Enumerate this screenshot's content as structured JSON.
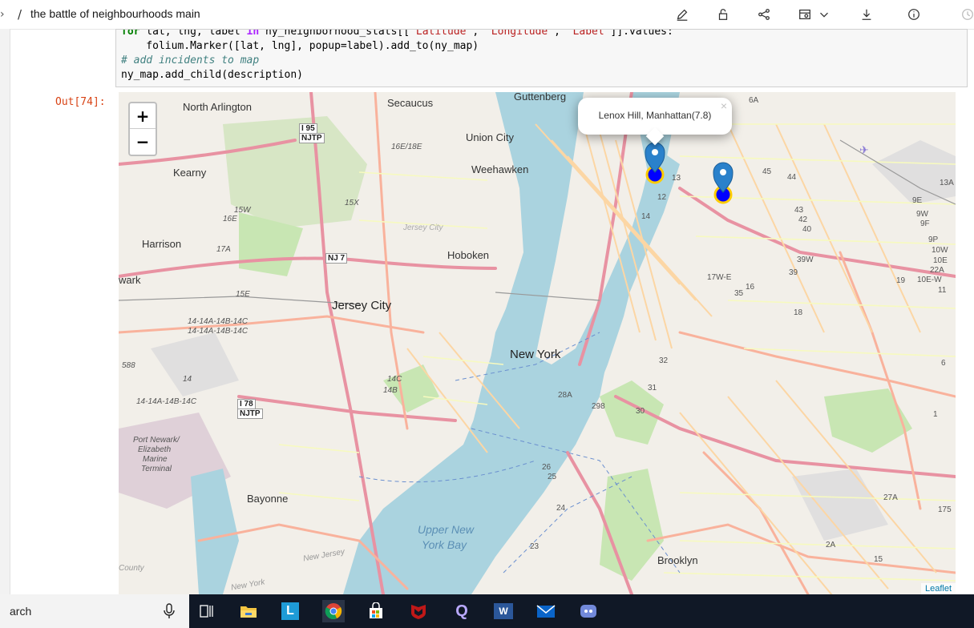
{
  "breadcrumb": {
    "separator_left": "›",
    "slash": "/",
    "title": "the battle of neighbourhoods main"
  },
  "toolbar": {
    "icons": [
      "edit-icon",
      "lock-icon",
      "share-icon",
      "version-icon",
      "chevron-down-icon",
      "download-icon",
      "info-icon"
    ]
  },
  "code": {
    "line1_kw": "for",
    "line1_mid": " lat, lng, label ",
    "line1_in": "in",
    "line1_rest": " ny_neighborhood_stats[[",
    "line1_s1": "'Latitude'",
    "line1_c1": ", ",
    "line1_s2": "'Longitude'",
    "line1_c2": ", ",
    "line1_s3": "'Label'",
    "line1_end": "]].values:",
    "line2": "    folium.Marker([lat, lng], popup=label).add_to(ny_map)",
    "line3": "# add incidents to map",
    "line4": "ny_map.add_child(description)"
  },
  "output": {
    "label": "Out[74]:"
  },
  "map": {
    "zoom_in": "+",
    "zoom_out": "−",
    "attribution": "Leaflet",
    "popup_text": "Lenox Hill, Manhattan(7.8)",
    "popup_close": "×",
    "labels": {
      "north_arlington": "North Arlington",
      "secaucus": "Secaucus",
      "guttenberg": "Guttenberg",
      "union_city": "Union City",
      "weehawken": "Weehawken",
      "kearny": "Kearny",
      "harrison": "Harrison",
      "newark": "wark",
      "hoboken": "Hoboken",
      "jersey_city": "Jersey City",
      "jersey_city_small": "Jersey City",
      "new_york": "New York",
      "bayonne": "Bayonne",
      "upper_new_york_bay_1": "Upper New",
      "upper_new_york_bay_2": "York Bay",
      "brooklyn": "Brooklyn",
      "port_newark_1": "Port Newark/",
      "port_newark_2": "Elizabeth",
      "port_newark_3": "Marine",
      "port_newark_4": "Terminal",
      "county": "County",
      "new_jersey": "New Jersey",
      "new_york_small": "New York",
      "i95": "I 95",
      "njtp1": "NJTP",
      "i78": "I 78",
      "njtp2": "NJTP",
      "nj7": "NJ 7",
      "exit_16e": "16E/18E",
      "exit_15w": "15W",
      "exit_16f": "16E",
      "exit_17a": "17A",
      "exit_14a": "14-14A-14B-14C",
      "exit_14a2": "14-14A-14B-14C",
      "exit_14a3": "14-14A-14B-14C",
      "exit_15e": "15E",
      "exit_14": "14",
      "exit_14b": "14B",
      "exit_14c": "14C",
      "exit_15x": "15X",
      "r588": "588",
      "r45": "45",
      "r44": "44",
      "r13a": "13A",
      "r9e": "9E",
      "r9w": "9W",
      "r9f": "9F",
      "r9p": "9P",
      "r10w": "10W",
      "r10e": "10E",
      "r22a": "22A",
      "r10ew": "10E-W",
      "r11": "11",
      "r39w": "39W",
      "r39": "39",
      "r17we": "17W-E",
      "r35": "35",
      "r16": "16",
      "r18": "18",
      "r19": "19",
      "r40": "40",
      "r42": "42",
      "r43": "43",
      "r32": "32",
      "r31": "31",
      "r30": "30",
      "r298": "298",
      "r28a": "28A",
      "r26": "26",
      "r25": "25",
      "r24": "24",
      "r23": "23",
      "r27a": "27A",
      "r175": "175",
      "r6": "6",
      "r1": "1",
      "r2a": "2A",
      "r15": "15",
      "r6a": "6A",
      "r13": "13",
      "r12": "12",
      "r14": "14"
    }
  },
  "taskbar": {
    "search_text": "arch",
    "apps": [
      "task-view-icon",
      "file-explorer-icon",
      "l-app-icon",
      "chrome-icon",
      "store-icon",
      "mcafee-icon",
      "q-app-icon",
      "word-icon",
      "mail-icon",
      "discord-icon"
    ],
    "l_glyph": "L",
    "q_glyph": "Q",
    "w_glyph": "W"
  },
  "colors": {
    "water": "#aad3df",
    "land": "#f2efe9",
    "park": "#c8e6b3",
    "motorway": "#e892a2",
    "trunk": "#f9b29c",
    "primary": "#fcd6a4",
    "secondary": "#f7fabf",
    "marker": "#2a81cb",
    "marker_circle": "#0000ff",
    "taskbar": "#101826",
    "out_label": "#d84315"
  }
}
